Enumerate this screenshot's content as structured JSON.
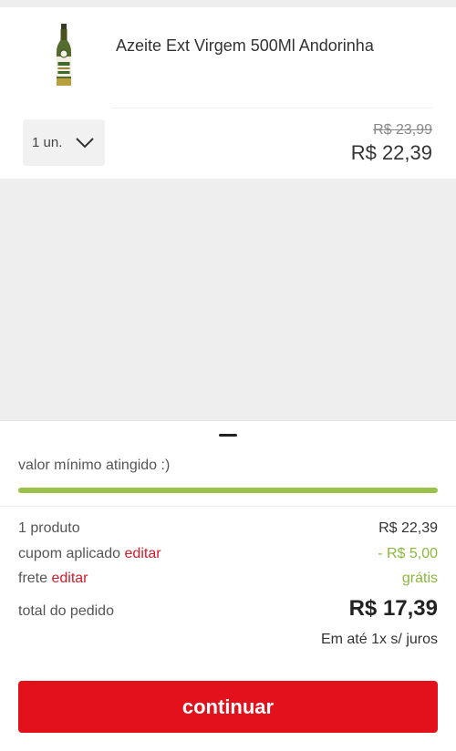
{
  "cart_item": {
    "name": "Azeite Ext Virgem 500Ml Andorinha",
    "image_icon": "olive-oil-bottle-icon",
    "quantity": "1 un.",
    "price_old": "R$ 23,99",
    "price_current": "R$ 22,39"
  },
  "summary": {
    "min_value_message": "valor mínimo atingido :)",
    "min_value_progress": 1.0,
    "products_label": "1 produto",
    "products_value": "R$ 22,39",
    "coupon_label": "cupom aplicado",
    "coupon_edit": "editar",
    "coupon_value": "- R$ 5,00",
    "shipping_label": "frete",
    "shipping_edit": "editar",
    "shipping_value": "grátis",
    "total_label": "total do pedido",
    "total_value": "R$ 17,39",
    "installments": "Em até 1x s/ juros"
  },
  "actions": {
    "continue_label": "continuar"
  },
  "colors": {
    "accent_red": "#e2111c",
    "success_green": "#8ab83a",
    "progress_green": "#9ac24a"
  }
}
